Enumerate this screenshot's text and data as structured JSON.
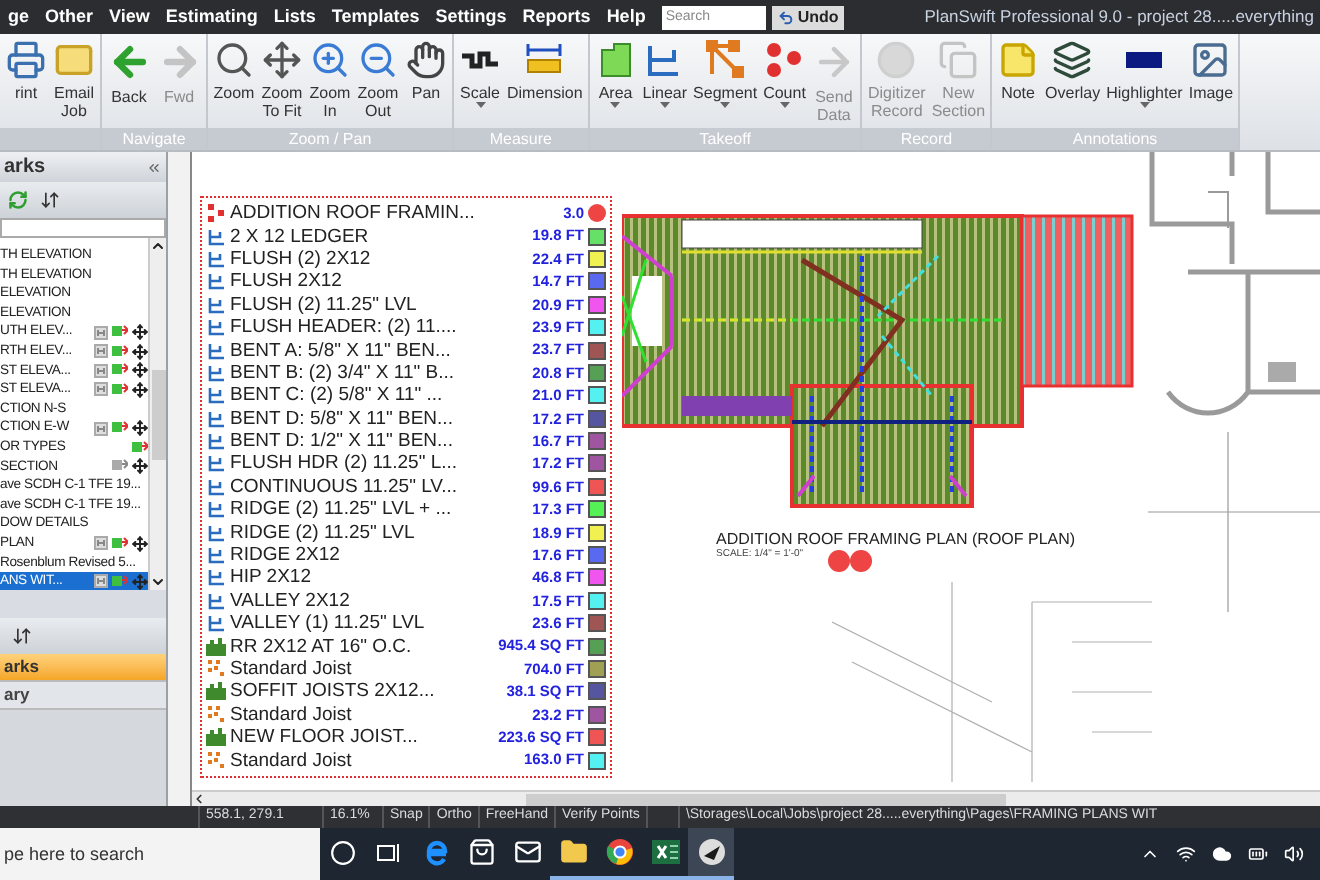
{
  "menu_bar": {
    "items": [
      "ge",
      "Other",
      "View",
      "Estimating",
      "Lists",
      "Templates",
      "Settings",
      "Reports",
      "Help"
    ],
    "search": {
      "placeholder": "Search"
    },
    "undo_button": "Undo",
    "window_title": "PlanSwift Professional 9.0 - project 28.....everything"
  },
  "ribbon": {
    "groups": [
      {
        "buttons": [
          {
            "label": "rint",
            "disabled": false
          },
          {
            "label": "Email Job",
            "disabled": false
          }
        ]
      },
      {
        "label": "Navigate",
        "buttons": [
          {
            "label": "Back",
            "disabled": false
          },
          {
            "label": "Fwd",
            "disabled": true
          }
        ]
      },
      {
        "label": "Zoom / Pan",
        "buttons": [
          {
            "label": "Zoom",
            "disabled": false
          },
          {
            "label": "Zoom To Fit",
            "disabled": false
          },
          {
            "label": "Zoom In",
            "disabled": false
          },
          {
            "label": "Zoom Out",
            "disabled": false
          },
          {
            "label": "Pan",
            "disabled": false
          }
        ]
      },
      {
        "label": "Measure",
        "buttons": [
          {
            "label": "Scale",
            "disabled": false
          },
          {
            "label": "Dimension",
            "disabled": false
          }
        ]
      },
      {
        "label": "Takeoff",
        "buttons": [
          {
            "label": "Area",
            "disabled": false
          },
          {
            "label": "Linear",
            "disabled": false
          },
          {
            "label": "Segment",
            "disabled": false
          },
          {
            "label": "Count",
            "disabled": false
          },
          {
            "label": "Send Data",
            "disabled": true
          }
        ]
      },
      {
        "label": "Record",
        "buttons": [
          {
            "label": "Digitizer Record",
            "disabled": true
          },
          {
            "label": "New Section",
            "disabled": true
          }
        ]
      },
      {
        "label": "Annotations",
        "buttons": [
          {
            "label": "Note",
            "disabled": false
          },
          {
            "label": "Overlay",
            "disabled": false
          },
          {
            "label": "Highlighter",
            "disabled": false
          },
          {
            "label": "Image",
            "disabled": false
          }
        ]
      }
    ]
  },
  "left_panel": {
    "title": "arks",
    "pages": [
      {
        "label": "TH ELEVATION",
        "selected": false
      },
      {
        "label": "TH ELEVATION",
        "selected": false
      },
      {
        "label": "ELEVATION",
        "selected": false
      },
      {
        "label": "ELEVATION",
        "selected": false
      },
      {
        "label": "UTH ELEV...",
        "selected": false
      },
      {
        "label": "RTH ELEV...",
        "selected": false
      },
      {
        "label": "ST ELEVA...",
        "selected": false
      },
      {
        "label": "ST ELEVA...",
        "selected": false
      },
      {
        "label": "CTION N-S",
        "selected": false
      },
      {
        "label": "CTION E-W",
        "selected": false
      },
      {
        "label": "OR TYPES",
        "selected": false
      },
      {
        "label": "SECTION",
        "selected": false
      },
      {
        "label": "ave SCDH C-1 TFE 19...",
        "selected": false
      },
      {
        "label": "ave SCDH C-1 TFE 19...",
        "selected": false
      },
      {
        "label": "DOW DETAILS",
        "selected": false
      },
      {
        "label": "PLAN",
        "selected": false
      },
      {
        "label": "Rosenblum Revised 5...",
        "selected": false
      },
      {
        "label": "ANS WIT...",
        "selected": true
      }
    ],
    "tabs": [
      {
        "label": "arks",
        "selected": true
      },
      {
        "label": "ary",
        "selected": false
      }
    ]
  },
  "takeoff_legend": {
    "items": [
      {
        "kind": "count",
        "name": "ADDITION ROOF FRAMIN...",
        "value": "3.0",
        "color": "#ee4444"
      },
      {
        "kind": "linear",
        "name": "2 X 12 LEDGER",
        "value": "19.8 FT",
        "color": "#66e066"
      },
      {
        "kind": "linear",
        "name": "FLUSH (2) 2X12",
        "value": "22.4 FT",
        "color": "#f0f050"
      },
      {
        "kind": "linear",
        "name": "FLUSH 2X12",
        "value": "14.7 FT",
        "color": "#5a6af0"
      },
      {
        "kind": "linear",
        "name": "FLUSH (2) 11.25\" LVL",
        "value": "20.9 FT",
        "color": "#f055f0"
      },
      {
        "kind": "linear",
        "name": "FLUSH HEADER: (2) 11....",
        "value": "23.9 FT",
        "color": "#55f0f0"
      },
      {
        "kind": "linear",
        "name": "BENT A: 5/8\" X 11\" BEN...",
        "value": "23.7 FT",
        "color": "#a05555"
      },
      {
        "kind": "linear",
        "name": "BENT B: (2) 3/4\" X 11\" B...",
        "value": "20.8 FT",
        "color": "#55a055"
      },
      {
        "kind": "linear",
        "name": "BENT C: (2) 5/8\" X 11\" ...",
        "value": "21.0 FT",
        "color": "#55f0f0"
      },
      {
        "kind": "linear",
        "name": "BENT D: 5/8\" X 11\" BEN...",
        "value": "17.2 FT",
        "color": "#5555a0"
      },
      {
        "kind": "linear",
        "name": "BENT D: 1/2\" X 11\" BEN...",
        "value": "16.7 FT",
        "color": "#a055a0"
      },
      {
        "kind": "linear",
        "name": "FLUSH HDR (2) 11.25\" L...",
        "value": "17.2 FT",
        "color": "#a055a0"
      },
      {
        "kind": "linear",
        "name": "CONTINUOUS 11.25\" LV...",
        "value": "99.6 FT",
        "color": "#f05555"
      },
      {
        "kind": "linear",
        "name": "RIDGE (2) 11.25\" LVL + ...",
        "value": "17.3 FT",
        "color": "#55f055"
      },
      {
        "kind": "linear",
        "name": "RIDGE (2) 11.25\" LVL",
        "value": "18.9 FT",
        "color": "#f0f050"
      },
      {
        "kind": "linear",
        "name": "RIDGE 2X12",
        "value": "17.6 FT",
        "color": "#5a6af0"
      },
      {
        "kind": "linear",
        "name": "HIP 2X12",
        "value": "46.8 FT",
        "color": "#f055f0"
      },
      {
        "kind": "linear",
        "name": "VALLEY 2X12",
        "value": "17.5 FT",
        "color": "#55f0f0"
      },
      {
        "kind": "linear",
        "name": "VALLEY (1) 11.25\" LVL",
        "value": "23.6 FT",
        "color": "#a05555"
      },
      {
        "kind": "area",
        "name": "RR 2X12 AT 16\" O.C.",
        "value": "945.4 SQ FT",
        "color": "#55a055"
      },
      {
        "kind": "segment",
        "name": "Standard Joist",
        "value": "704.0 FT",
        "color": "#a0a055"
      },
      {
        "kind": "area",
        "name": "SOFFIT JOISTS 2X12...",
        "value": "38.1 SQ FT",
        "color": "#5555a0"
      },
      {
        "kind": "segment",
        "name": "Standard Joist",
        "value": "23.2 FT",
        "color": "#a055a0"
      },
      {
        "kind": "area",
        "name": "NEW FLOOR JOIST...",
        "value": "223.6 SQ FT",
        "color": "#f05555"
      },
      {
        "kind": "segment",
        "name": "Standard Joist",
        "value": "163.0 FT",
        "color": "#55f0f0"
      }
    ]
  },
  "drawing": {
    "title": "ADDITION ROOF FRAMING PLAN (ROOF PLAN)",
    "scale": "SCALE: 1/4\" = 1'-0\""
  },
  "status_bar": {
    "coordinates": "558.1, 279.1",
    "zoom": "16.1%",
    "toggles": [
      "Snap",
      "Ortho",
      "FreeHand",
      "Verify Points"
    ],
    "path": "\\Storages\\Local\\Jobs\\project 28.....everything\\Pages\\FRAMING PLANS WIT"
  },
  "taskbar": {
    "search": {
      "placeholder": "pe here to search"
    },
    "apps": [
      {
        "running": false,
        "selected": false
      },
      {
        "running": false,
        "selected": false
      },
      {
        "running": false,
        "selected": false
      },
      {
        "running": false,
        "selected": false
      },
      {
        "running": false,
        "selected": false
      },
      {
        "running": true,
        "selected": false
      },
      {
        "running": true,
        "selected": false
      },
      {
        "running": true,
        "selected": false
      },
      {
        "running": true,
        "selected": true
      }
    ]
  }
}
